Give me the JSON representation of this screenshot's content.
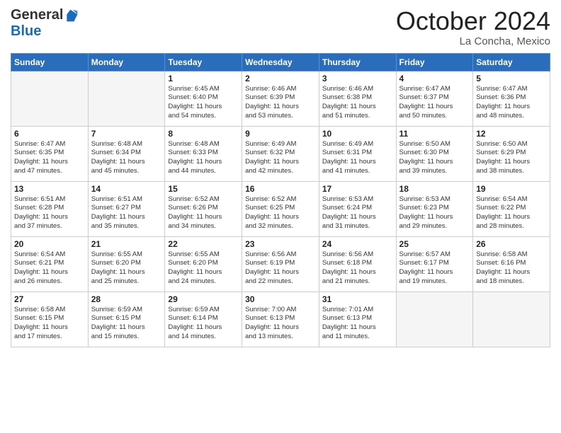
{
  "header": {
    "logo_general": "General",
    "logo_blue": "Blue",
    "month_title": "October 2024",
    "location": "La Concha, Mexico"
  },
  "weekdays": [
    "Sunday",
    "Monday",
    "Tuesday",
    "Wednesday",
    "Thursday",
    "Friday",
    "Saturday"
  ],
  "weeks": [
    [
      {
        "day": "",
        "info": ""
      },
      {
        "day": "",
        "info": ""
      },
      {
        "day": "1",
        "info": "Sunrise: 6:45 AM\nSunset: 6:40 PM\nDaylight: 11 hours\nand 54 minutes."
      },
      {
        "day": "2",
        "info": "Sunrise: 6:46 AM\nSunset: 6:39 PM\nDaylight: 11 hours\nand 53 minutes."
      },
      {
        "day": "3",
        "info": "Sunrise: 6:46 AM\nSunset: 6:38 PM\nDaylight: 11 hours\nand 51 minutes."
      },
      {
        "day": "4",
        "info": "Sunrise: 6:47 AM\nSunset: 6:37 PM\nDaylight: 11 hours\nand 50 minutes."
      },
      {
        "day": "5",
        "info": "Sunrise: 6:47 AM\nSunset: 6:36 PM\nDaylight: 11 hours\nand 48 minutes."
      }
    ],
    [
      {
        "day": "6",
        "info": "Sunrise: 6:47 AM\nSunset: 6:35 PM\nDaylight: 11 hours\nand 47 minutes."
      },
      {
        "day": "7",
        "info": "Sunrise: 6:48 AM\nSunset: 6:34 PM\nDaylight: 11 hours\nand 45 minutes."
      },
      {
        "day": "8",
        "info": "Sunrise: 6:48 AM\nSunset: 6:33 PM\nDaylight: 11 hours\nand 44 minutes."
      },
      {
        "day": "9",
        "info": "Sunrise: 6:49 AM\nSunset: 6:32 PM\nDaylight: 11 hours\nand 42 minutes."
      },
      {
        "day": "10",
        "info": "Sunrise: 6:49 AM\nSunset: 6:31 PM\nDaylight: 11 hours\nand 41 minutes."
      },
      {
        "day": "11",
        "info": "Sunrise: 6:50 AM\nSunset: 6:30 PM\nDaylight: 11 hours\nand 39 minutes."
      },
      {
        "day": "12",
        "info": "Sunrise: 6:50 AM\nSunset: 6:29 PM\nDaylight: 11 hours\nand 38 minutes."
      }
    ],
    [
      {
        "day": "13",
        "info": "Sunrise: 6:51 AM\nSunset: 6:28 PM\nDaylight: 11 hours\nand 37 minutes."
      },
      {
        "day": "14",
        "info": "Sunrise: 6:51 AM\nSunset: 6:27 PM\nDaylight: 11 hours\nand 35 minutes."
      },
      {
        "day": "15",
        "info": "Sunrise: 6:52 AM\nSunset: 6:26 PM\nDaylight: 11 hours\nand 34 minutes."
      },
      {
        "day": "16",
        "info": "Sunrise: 6:52 AM\nSunset: 6:25 PM\nDaylight: 11 hours\nand 32 minutes."
      },
      {
        "day": "17",
        "info": "Sunrise: 6:53 AM\nSunset: 6:24 PM\nDaylight: 11 hours\nand 31 minutes."
      },
      {
        "day": "18",
        "info": "Sunrise: 6:53 AM\nSunset: 6:23 PM\nDaylight: 11 hours\nand 29 minutes."
      },
      {
        "day": "19",
        "info": "Sunrise: 6:54 AM\nSunset: 6:22 PM\nDaylight: 11 hours\nand 28 minutes."
      }
    ],
    [
      {
        "day": "20",
        "info": "Sunrise: 6:54 AM\nSunset: 6:21 PM\nDaylight: 11 hours\nand 26 minutes."
      },
      {
        "day": "21",
        "info": "Sunrise: 6:55 AM\nSunset: 6:20 PM\nDaylight: 11 hours\nand 25 minutes."
      },
      {
        "day": "22",
        "info": "Sunrise: 6:55 AM\nSunset: 6:20 PM\nDaylight: 11 hours\nand 24 minutes."
      },
      {
        "day": "23",
        "info": "Sunrise: 6:56 AM\nSunset: 6:19 PM\nDaylight: 11 hours\nand 22 minutes."
      },
      {
        "day": "24",
        "info": "Sunrise: 6:56 AM\nSunset: 6:18 PM\nDaylight: 11 hours\nand 21 minutes."
      },
      {
        "day": "25",
        "info": "Sunrise: 6:57 AM\nSunset: 6:17 PM\nDaylight: 11 hours\nand 19 minutes."
      },
      {
        "day": "26",
        "info": "Sunrise: 6:58 AM\nSunset: 6:16 PM\nDaylight: 11 hours\nand 18 minutes."
      }
    ],
    [
      {
        "day": "27",
        "info": "Sunrise: 6:58 AM\nSunset: 6:15 PM\nDaylight: 11 hours\nand 17 minutes."
      },
      {
        "day": "28",
        "info": "Sunrise: 6:59 AM\nSunset: 6:15 PM\nDaylight: 11 hours\nand 15 minutes."
      },
      {
        "day": "29",
        "info": "Sunrise: 6:59 AM\nSunset: 6:14 PM\nDaylight: 11 hours\nand 14 minutes."
      },
      {
        "day": "30",
        "info": "Sunrise: 7:00 AM\nSunset: 6:13 PM\nDaylight: 11 hours\nand 13 minutes."
      },
      {
        "day": "31",
        "info": "Sunrise: 7:01 AM\nSunset: 6:13 PM\nDaylight: 11 hours\nand 11 minutes."
      },
      {
        "day": "",
        "info": ""
      },
      {
        "day": "",
        "info": ""
      }
    ]
  ]
}
